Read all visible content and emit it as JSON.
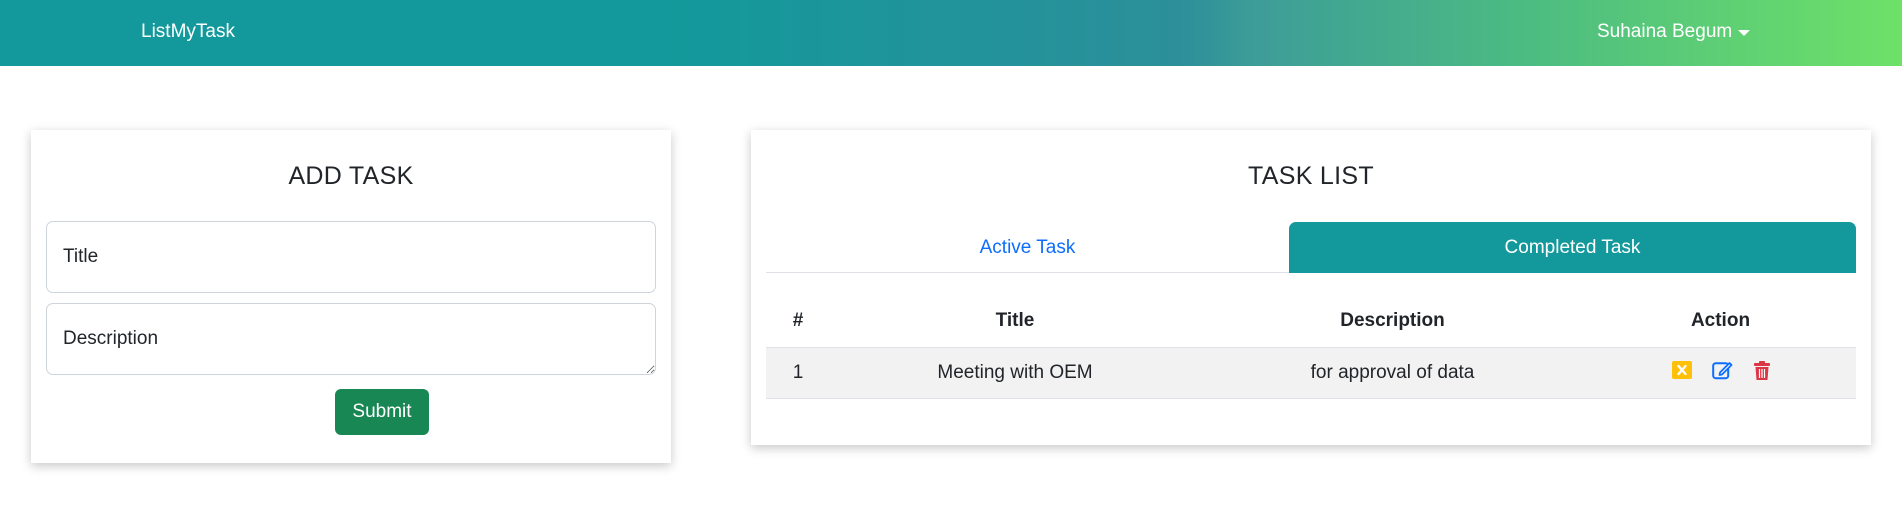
{
  "navbar": {
    "brand": "ListMyTask",
    "user_name": "Suhaina Begum",
    "gradient_start": "#13999b",
    "gradient_end": "#6ee168"
  },
  "add_task": {
    "title": "ADD TASK",
    "title_placeholder": "Title",
    "description_placeholder": "Description",
    "submit_label": "Submit",
    "submit_color": "#198754"
  },
  "task_list": {
    "title": "TASK LIST",
    "tabs": [
      {
        "label": "Active Task",
        "selected": false
      },
      {
        "label": "Completed Task",
        "selected": true
      }
    ],
    "columns": [
      "#",
      "Title",
      "Description",
      "Action"
    ],
    "rows": [
      {
        "num": "1",
        "title": "Meeting with OEM",
        "description": "for approval of data",
        "actions": [
          {
            "icon": "x-square-icon",
            "color": "#ffc107"
          },
          {
            "icon": "edit-icon",
            "color": "#0d6efd"
          },
          {
            "icon": "trash-icon",
            "color": "#dc3545"
          }
        ]
      }
    ]
  }
}
